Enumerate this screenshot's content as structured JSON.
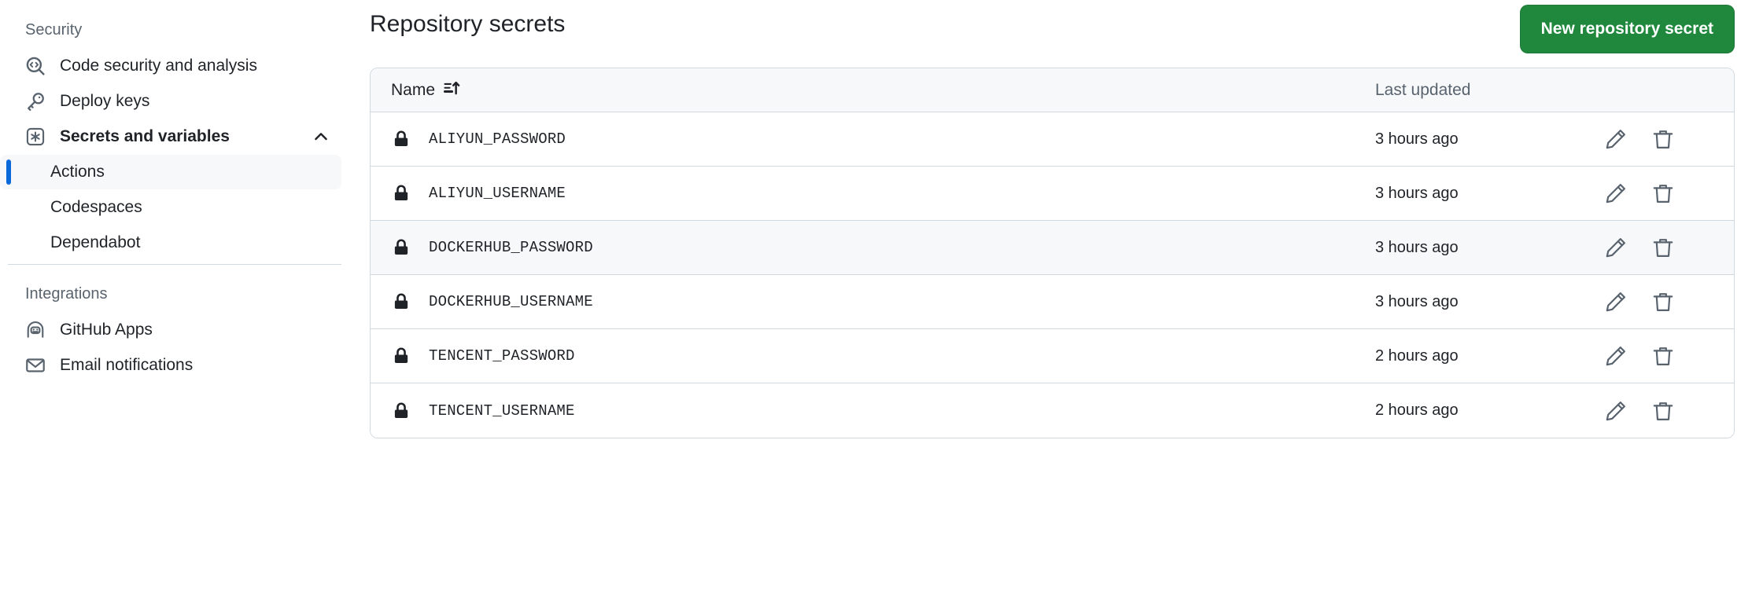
{
  "sidebar": {
    "sections": [
      {
        "title": "Security"
      },
      {
        "title": "Integrations"
      }
    ],
    "security_items": [
      {
        "label": "Code security and analysis",
        "icon": "code-scan-icon"
      },
      {
        "label": "Deploy keys",
        "icon": "key-icon"
      },
      {
        "label": "Secrets and variables",
        "icon": "asterisk-box-icon",
        "expanded": true,
        "chevron": "chevron-up-icon"
      }
    ],
    "secrets_subitems": [
      {
        "label": "Actions",
        "active": true
      },
      {
        "label": "Codespaces",
        "active": false
      },
      {
        "label": "Dependabot",
        "active": false
      }
    ],
    "integrations_items": [
      {
        "label": "GitHub Apps",
        "icon": "apps-robot-icon"
      },
      {
        "label": "Email notifications",
        "icon": "mail-icon"
      }
    ]
  },
  "main": {
    "title": "Repository secrets",
    "new_secret_button": "New repository secret",
    "accent_color": "#1f883d",
    "active_indicator_color": "#0969da",
    "table": {
      "columns": {
        "name": "Name",
        "name_sort_icon": "sort-ascending-icon",
        "last_updated": "Last updated"
      },
      "rows": [
        {
          "icon": "lock-icon",
          "name": "ALIYUN_PASSWORD",
          "last_updated": "3 hours ago",
          "edit_icon": "pencil-icon",
          "delete_icon": "trash-icon",
          "hovered": false
        },
        {
          "icon": "lock-icon",
          "name": "ALIYUN_USERNAME",
          "last_updated": "3 hours ago",
          "edit_icon": "pencil-icon",
          "delete_icon": "trash-icon",
          "hovered": false
        },
        {
          "icon": "lock-icon",
          "name": "DOCKERHUB_PASSWORD",
          "last_updated": "3 hours ago",
          "edit_icon": "pencil-icon",
          "delete_icon": "trash-icon",
          "hovered": true
        },
        {
          "icon": "lock-icon",
          "name": "DOCKERHUB_USERNAME",
          "last_updated": "3 hours ago",
          "edit_icon": "pencil-icon",
          "delete_icon": "trash-icon",
          "hovered": false
        },
        {
          "icon": "lock-icon",
          "name": "TENCENT_PASSWORD",
          "last_updated": "2 hours ago",
          "edit_icon": "pencil-icon",
          "delete_icon": "trash-icon",
          "hovered": false
        },
        {
          "icon": "lock-icon",
          "name": "TENCENT_USERNAME",
          "last_updated": "2 hours ago",
          "edit_icon": "pencil-icon",
          "delete_icon": "trash-icon",
          "hovered": false
        }
      ]
    }
  }
}
